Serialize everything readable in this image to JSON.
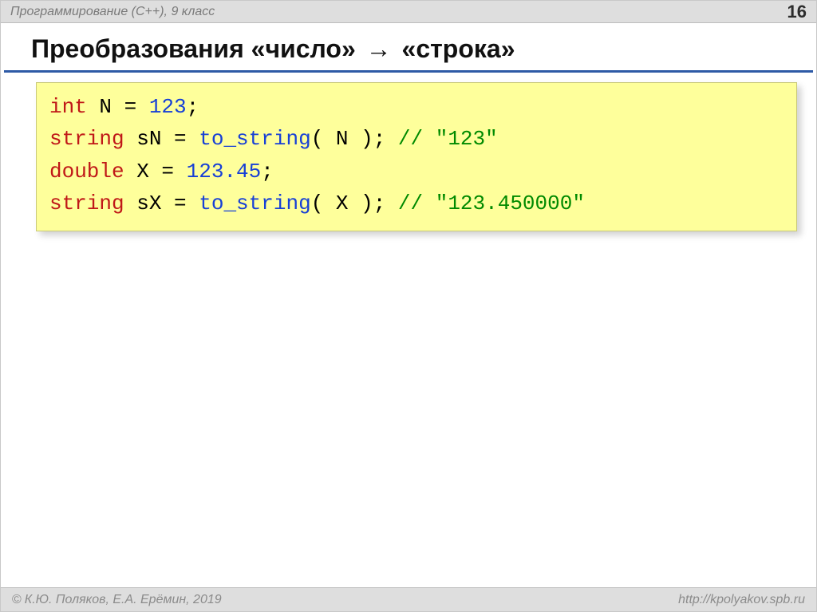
{
  "header": {
    "course": "Программирование (C++), 9 класс",
    "page": "16"
  },
  "title": {
    "left": "Преобразования «число»",
    "arrow": "→",
    "right": "«строка»"
  },
  "code": {
    "l1": {
      "kw": "int",
      "rest": " N = ",
      "num": "123",
      "semi": ";"
    },
    "l2": {
      "kw": "string",
      "pre": " sN = ",
      "fn": "to_string",
      "args": "( N ); ",
      "cmt": "// \"123\""
    },
    "l3": {
      "kw": "double",
      "rest": " X = ",
      "num": "123.45",
      "semi": ";"
    },
    "l4": {
      "kw": "string",
      "pre": " sX = ",
      "fn": "to_string",
      "args": "( X ); ",
      "cmt": "// \"123.450000\""
    }
  },
  "footer": {
    "copyright_symbol": "©",
    "authors": "К.Ю. Поляков, Е.А. Ерёмин, 2019",
    "url": "http://kpolyakov.spb.ru"
  }
}
